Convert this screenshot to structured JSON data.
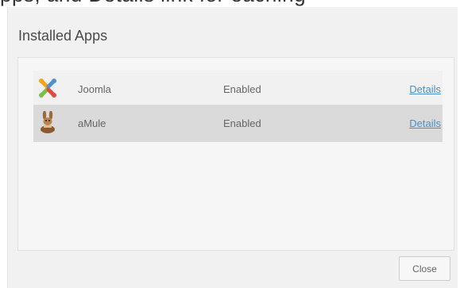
{
  "header_fragment": "pps, and Details link for eaching",
  "dialog": {
    "title": "Installed Apps",
    "close_label": "Close"
  },
  "apps": [
    {
      "name": "Joomla",
      "status": "Enabled",
      "link_label": "Details",
      "icon": "joomla-icon"
    },
    {
      "name": "aMule",
      "status": "Enabled",
      "link_label": "Details",
      "icon": "amule-icon"
    }
  ],
  "colors": {
    "link": "#4a90c8",
    "joomla_colors": [
      "#e2493f",
      "#f7a21b",
      "#5091cd",
      "#7ac143"
    ]
  }
}
